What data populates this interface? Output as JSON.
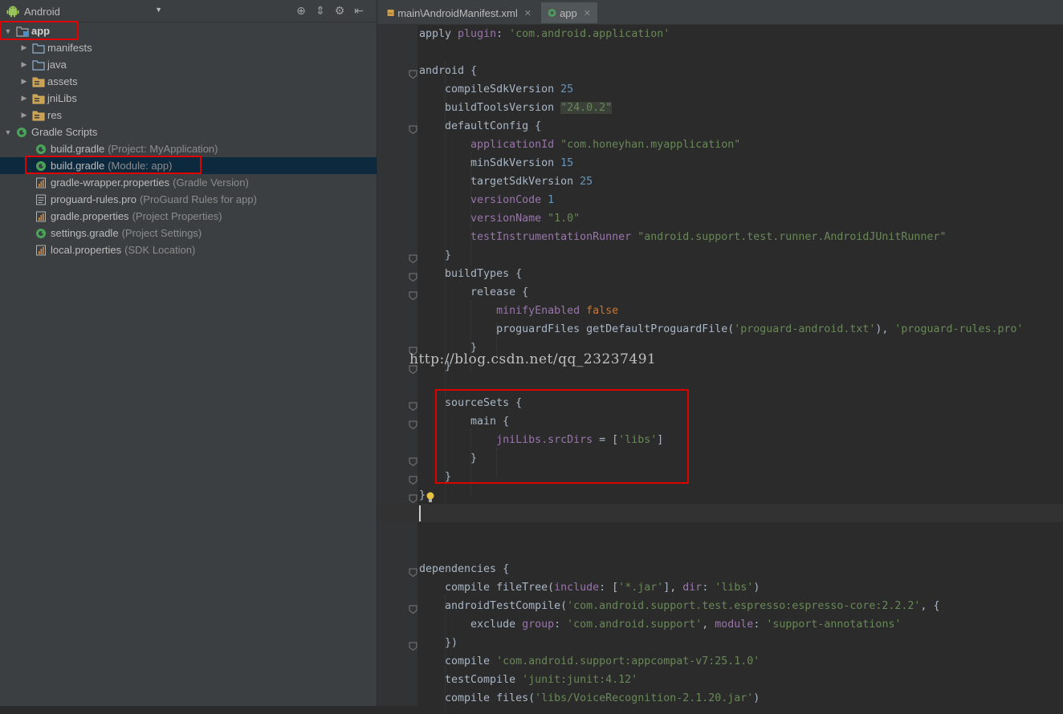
{
  "project_panel": {
    "view_selector": "Android",
    "tree": [
      {
        "name": "app",
        "hint": "",
        "level": 0,
        "arrow": "▼",
        "icon": "module",
        "bold": true
      },
      {
        "name": "manifests",
        "hint": "",
        "level": 1,
        "arrow": "▶",
        "icon": "folder"
      },
      {
        "name": "java",
        "hint": "",
        "level": 1,
        "arrow": "▶",
        "icon": "folder"
      },
      {
        "name": "assets",
        "hint": "",
        "level": 1,
        "arrow": "▶",
        "icon": "res-folder"
      },
      {
        "name": "jniLibs",
        "hint": "",
        "level": 1,
        "arrow": "▶",
        "icon": "res-folder"
      },
      {
        "name": "res",
        "hint": "",
        "level": 1,
        "arrow": "▶",
        "icon": "res-folder"
      },
      {
        "name": "Gradle Scripts",
        "hint": "",
        "level": 0,
        "arrow": "▼",
        "icon": "gradle"
      },
      {
        "name": "build.gradle",
        "hint": "(Project: MyApplication)",
        "level": 2,
        "arrow": "",
        "icon": "gradle"
      },
      {
        "name": "build.gradle",
        "hint": "(Module: app)",
        "level": 2,
        "arrow": "",
        "icon": "gradle",
        "selected": true
      },
      {
        "name": "gradle-wrapper.properties",
        "hint": "(Gradle Version)",
        "level": 2,
        "arrow": "",
        "icon": "properties"
      },
      {
        "name": "proguard-rules.pro",
        "hint": "(ProGuard Rules for app)",
        "level": 2,
        "arrow": "",
        "icon": "file"
      },
      {
        "name": "gradle.properties",
        "hint": "(Project Properties)",
        "level": 2,
        "arrow": "",
        "icon": "properties"
      },
      {
        "name": "settings.gradle",
        "hint": "(Project Settings)",
        "level": 2,
        "arrow": "",
        "icon": "gradle"
      },
      {
        "name": "local.properties",
        "hint": "(SDK Location)",
        "level": 2,
        "arrow": "",
        "icon": "properties"
      }
    ]
  },
  "editor": {
    "tabs": [
      {
        "label": "main\\AndroidManifest.xml",
        "active": false
      },
      {
        "label": "app",
        "active": true
      }
    ],
    "lines": [
      [
        [
          "kw",
          "apply "
        ],
        [
          "prop",
          "plugin"
        ],
        [
          "kw",
          ": "
        ],
        [
          "str",
          "'com.android.application'"
        ]
      ],
      [],
      [
        [
          "kw",
          "android {"
        ]
      ],
      [
        [
          "kw",
          "    compileSdkVersion "
        ],
        [
          "num",
          "25"
        ]
      ],
      [
        [
          "kw",
          "    buildToolsVersion "
        ],
        [
          "strhl",
          "\"24.0.2\""
        ]
      ],
      [
        [
          "kw",
          "    defaultConfig {"
        ]
      ],
      [
        [
          "prop",
          "        applicationId "
        ],
        [
          "str",
          "\"com.honeyhan.myapplication\""
        ]
      ],
      [
        [
          "kw",
          "        minSdkVersion "
        ],
        [
          "num",
          "15"
        ]
      ],
      [
        [
          "kw",
          "        targetSdkVersion "
        ],
        [
          "num",
          "25"
        ]
      ],
      [
        [
          "prop",
          "        versionCode "
        ],
        [
          "num",
          "1"
        ]
      ],
      [
        [
          "prop",
          "        versionName "
        ],
        [
          "str",
          "\"1.0\""
        ]
      ],
      [
        [
          "prop",
          "        testInstrumentationRunner "
        ],
        [
          "str",
          "\"android.support.test.runner.AndroidJUnitRunner\""
        ]
      ],
      [
        [
          "kw",
          "    }"
        ]
      ],
      [
        [
          "kw",
          "    buildTypes {"
        ]
      ],
      [
        [
          "kw",
          "        release {"
        ]
      ],
      [
        [
          "prop",
          "            minifyEnabled "
        ],
        [
          "bool",
          "false"
        ]
      ],
      [
        [
          "kw",
          "            proguardFiles getDefaultProguardFile("
        ],
        [
          "str",
          "'proguard-android.txt'"
        ],
        [
          "kw",
          "), "
        ],
        [
          "str",
          "'proguard-rules.pro'"
        ]
      ],
      [
        [
          "kw",
          "        }"
        ]
      ],
      [
        [
          "kw",
          "    }"
        ]
      ],
      [],
      [
        [
          "kw",
          "    sourceSets {"
        ]
      ],
      [
        [
          "kw",
          "        main {"
        ]
      ],
      [
        [
          "prop",
          "            jniLibs.srcDirs"
        ],
        [
          "kw",
          " = ["
        ],
        [
          "str",
          "'libs'"
        ],
        [
          "kw",
          "]"
        ]
      ],
      [
        [
          "kw",
          "        }"
        ]
      ],
      [
        [
          "kw",
          "    }"
        ]
      ],
      [
        [
          "kw",
          "}"
        ]
      ],
      [],
      [],
      [],
      [
        [
          "kw",
          "dependencies {"
        ]
      ],
      [
        [
          "kw",
          "    compile fileTree("
        ],
        [
          "prop",
          "include"
        ],
        [
          "kw",
          ": ["
        ],
        [
          "str",
          "'*.jar'"
        ],
        [
          "kw",
          "], "
        ],
        [
          "prop",
          "dir"
        ],
        [
          "kw",
          ": "
        ],
        [
          "str",
          "'libs'"
        ],
        [
          "kw",
          ")"
        ]
      ],
      [
        [
          "kw",
          "    androidTestCompile("
        ],
        [
          "str",
          "'com.android.support.test.espresso:espresso-core:2.2.2'"
        ],
        [
          "kw",
          ", {"
        ]
      ],
      [
        [
          "kw",
          "        exclude "
        ],
        [
          "prop",
          "group"
        ],
        [
          "kw",
          ": "
        ],
        [
          "str",
          "'com.android.support'"
        ],
        [
          "kw",
          ", "
        ],
        [
          "prop",
          "module"
        ],
        [
          "kw",
          ": "
        ],
        [
          "str",
          "'support-annotations'"
        ]
      ],
      [
        [
          "kw",
          "    })"
        ]
      ],
      [
        [
          "kw",
          "    compile "
        ],
        [
          "str",
          "'com.android.support:appcompat-v7:25.1.0'"
        ]
      ],
      [
        [
          "kw",
          "    testCompile "
        ],
        [
          "str",
          "'junit:junit:4.12'"
        ]
      ],
      [
        [
          "kw",
          "    compile files("
        ],
        [
          "str",
          "'libs/VoiceRecognition-2.1.20.jar'"
        ],
        [
          "kw",
          ")"
        ]
      ]
    ]
  },
  "watermark": "http://blog.csdn.net/qq_23237491",
  "colors": {
    "highlight_box": "#e00000",
    "selection": "#0d293e",
    "string": "#6a8759",
    "number": "#6897bb",
    "property": "#9876aa",
    "keyword_bool": "#cc7832"
  }
}
